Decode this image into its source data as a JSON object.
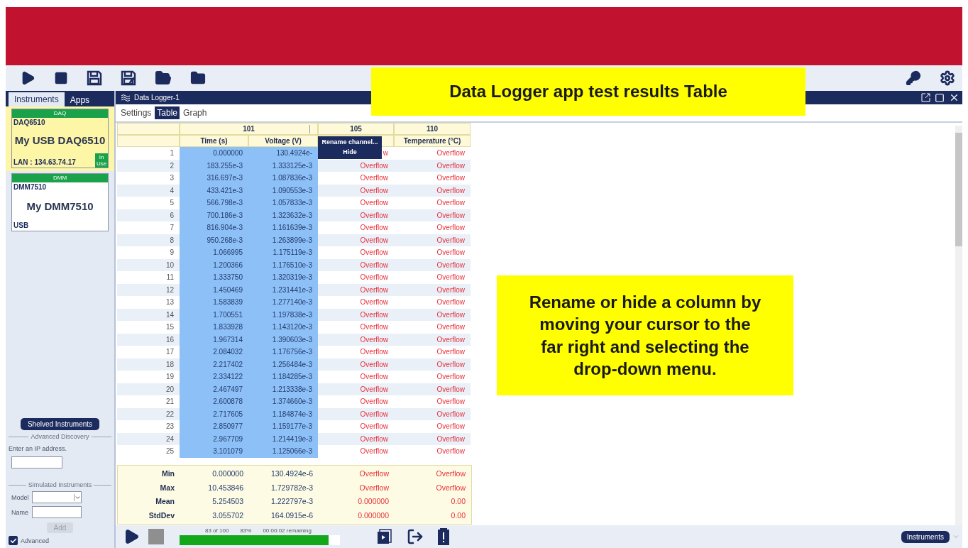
{
  "sidebar": {
    "tabs": [
      {
        "label": "Instruments",
        "selected": true
      },
      {
        "label": "Apps",
        "selected": false
      }
    ],
    "instruments": [
      {
        "category": "DAQ",
        "model": "DAQ6510",
        "name": "My USB DAQ6510",
        "connection": "LAN : 134.63.74.17",
        "badge": "In Use",
        "selected": true
      },
      {
        "category": "DMM",
        "model": "DMM7510",
        "name": "My DMM7510",
        "connection": "USB",
        "selected": false
      }
    ],
    "shelved_button": "Shelved Instruments",
    "advanced_discovery": {
      "title": "Advanced Discovery",
      "label": "Enter an IP address."
    },
    "simulated": {
      "title": "Simulated Instruments",
      "model_label": "Model",
      "name_label": "Name",
      "add_button": {
        "label": "Add",
        "disabled": true
      }
    },
    "advanced": {
      "label": "Advanced",
      "checked": true
    }
  },
  "app_window": {
    "title": "Data Logger-1",
    "tabs": [
      {
        "label": "Settings",
        "selected": false
      },
      {
        "label": "Table",
        "selected": true
      },
      {
        "label": "Graph",
        "selected": false
      }
    ]
  },
  "table": {
    "channels": [
      {
        "label": "101",
        "error": false,
        "columns": [
          {
            "label": "Time (s)",
            "selected": true
          },
          {
            "label": "Voltage (V)",
            "selected": true
          }
        ]
      },
      {
        "label": "105",
        "error": true,
        "columns": [
          {
            "selected": false
          }
        ]
      },
      {
        "label": "110",
        "error": true,
        "columns": [
          {
            "label": "Temperature (°C)",
            "selected": false
          }
        ]
      }
    ],
    "rows": [
      {
        "index": "1",
        "cells": [
          "0.000000",
          "130.4924e-",
          "w",
          "Overflow"
        ]
      },
      {
        "index": "2",
        "cells": [
          "183.255e-3",
          "1.333125e-3",
          "Overflow",
          "Overflow"
        ]
      },
      {
        "index": "3",
        "cells": [
          "316.697e-3",
          "1.087836e-3",
          "Overflow",
          "Overflow"
        ]
      },
      {
        "index": "4",
        "cells": [
          "433.421e-3",
          "1.090553e-3",
          "Overflow",
          "Overflow"
        ]
      },
      {
        "index": "5",
        "cells": [
          "566.798e-3",
          "1.057833e-3",
          "Overflow",
          "Overflow"
        ]
      },
      {
        "index": "6",
        "cells": [
          "700.186e-3",
          "1.323632e-3",
          "Overflow",
          "Overflow"
        ]
      },
      {
        "index": "7",
        "cells": [
          "816.904e-3",
          "1.161639e-3",
          "Overflow",
          "Overflow"
        ]
      },
      {
        "index": "8",
        "cells": [
          "950.268e-3",
          "1.263899e-3",
          "Overflow",
          "Overflow"
        ]
      },
      {
        "index": "9",
        "cells": [
          "1.066995",
          "1.175119e-3",
          "Overflow",
          "Overflow"
        ]
      },
      {
        "index": "10",
        "cells": [
          "1.200366",
          "1.176510e-3",
          "Overflow",
          "Overflow"
        ]
      },
      {
        "index": "11",
        "cells": [
          "1.333750",
          "1.320319e-3",
          "Overflow",
          "Overflow"
        ]
      },
      {
        "index": "12",
        "cells": [
          "1.450469",
          "1.231441e-3",
          "Overflow",
          "Overflow"
        ]
      },
      {
        "index": "13",
        "cells": [
          "1.583839",
          "1.277140e-3",
          "Overflow",
          "Overflow"
        ]
      },
      {
        "index": "14",
        "cells": [
          "1.700551",
          "1.197838e-3",
          "Overflow",
          "Overflow"
        ]
      },
      {
        "index": "15",
        "cells": [
          "1.833928",
          "1.143120e-3",
          "Overflow",
          "Overflow"
        ]
      },
      {
        "index": "16",
        "cells": [
          "1.967314",
          "1.390603e-3",
          "Overflow",
          "Overflow"
        ]
      },
      {
        "index": "17",
        "cells": [
          "2.084032",
          "1.176756e-3",
          "Overflow",
          "Overflow"
        ]
      },
      {
        "index": "18",
        "cells": [
          "2.217402",
          "1.256484e-3",
          "Overflow",
          "Overflow"
        ]
      },
      {
        "index": "19",
        "cells": [
          "2.334122",
          "1.184285e-3",
          "Overflow",
          "Overflow"
        ]
      },
      {
        "index": "20",
        "cells": [
          "2.467497",
          "1.213338e-3",
          "Overflow",
          "Overflow"
        ]
      },
      {
        "index": "21",
        "cells": [
          "2.600878",
          "1.374660e-3",
          "Overflow",
          "Overflow"
        ]
      },
      {
        "index": "22",
        "cells": [
          "2.717605",
          "1.184874e-3",
          "Overflow",
          "Overflow"
        ]
      },
      {
        "index": "23",
        "cells": [
          "2.850977",
          "1.159177e-3",
          "Overflow",
          "Overflow"
        ]
      },
      {
        "index": "24",
        "cells": [
          "2.967709",
          "1.214419e-3",
          "Overflow",
          "Overflow"
        ]
      },
      {
        "index": "25",
        "cells": [
          "3.101079",
          "1.125066e-3",
          "Overflow",
          "Overflow"
        ]
      }
    ],
    "stats": [
      {
        "label": "Min",
        "cells": [
          "0.000000",
          "130.4924e-6",
          "Overflow",
          "Overflow"
        ]
      },
      {
        "label": "Max",
        "cells": [
          "10.453846",
          "1.729782e-3",
          "Overflow",
          "Overflow"
        ]
      },
      {
        "label": "Mean",
        "cells": [
          "5.254503",
          "1.222797e-3",
          "0.000000",
          "0.00"
        ]
      },
      {
        "label": "StdDev",
        "cells": [
          "3.055702",
          "164.0915e-6",
          "0.000000",
          "0.00"
        ]
      }
    ]
  },
  "context_menu": {
    "items": [
      "Rename channel...",
      "Hide"
    ]
  },
  "run_controls": {
    "stop_disabled": true
  },
  "progress": {
    "count": "83 of 100",
    "percent": "83%",
    "remaining": "00:00:02 remaining",
    "level": 0.93
  },
  "footer_button": "Instruments",
  "callouts": [
    {
      "text": "Data Logger app test results Table"
    },
    {
      "text": "Rename or hide a column by moving your cursor to the far right and selecting the drop-down menu."
    }
  ]
}
